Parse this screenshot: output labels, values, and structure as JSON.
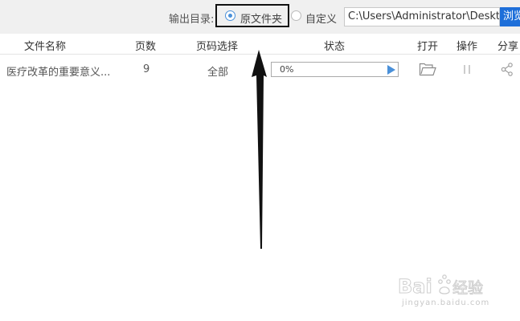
{
  "toolbar": {
    "output_label": "输出目录:",
    "option_original": "原文件夹",
    "option_custom": "自定义",
    "path_value": "C:\\Users\\Administrator\\Desktop",
    "browse_label": "浏览"
  },
  "table": {
    "headers": [
      "文件名称",
      "页数",
      "页码选择",
      "状态",
      "打开",
      "操作",
      "分享"
    ],
    "rows": [
      {
        "filename": "医疗改革的重要意义...",
        "pages": "9",
        "page_selection": "全部",
        "progress_text": "0%",
        "progress_value": 0
      }
    ]
  },
  "watermark": {
    "brand": "Bai度经验",
    "url": "jingyan.baidu.com"
  },
  "colors": {
    "accent": "#4a90d9",
    "browse_button": "#1e6fd9",
    "annotation": "#111111"
  },
  "icons": {
    "open": "folder-icon",
    "action": "pause-icon",
    "share": "share-icon",
    "start": "play-icon"
  }
}
